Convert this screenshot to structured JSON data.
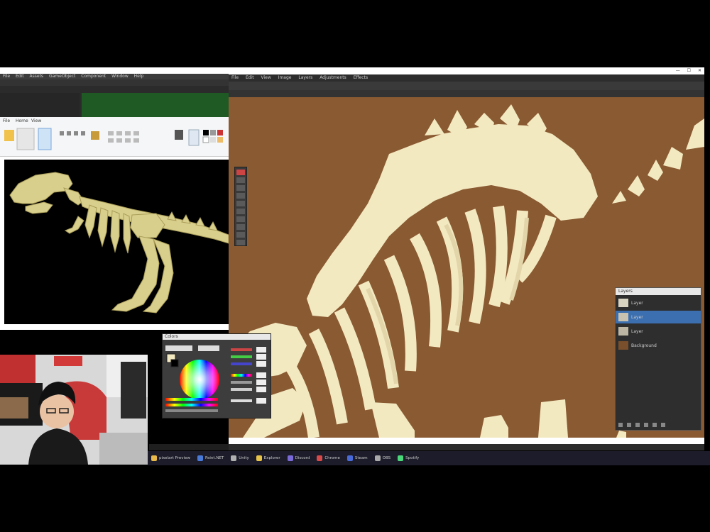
{
  "left_app": {
    "menu": [
      "File",
      "Edit",
      "Assets",
      "GameObject",
      "Component",
      "Window",
      "Help"
    ]
  },
  "paint": {
    "tabs": [
      "File",
      "Home",
      "View"
    ]
  },
  "editor": {
    "menu": [
      "File",
      "Edit",
      "View",
      "Image",
      "Layers",
      "Adjustments",
      "Effects"
    ],
    "statusbar_text": "",
    "window_controls": [
      "—",
      "☐",
      "✕"
    ]
  },
  "colors_panel": {
    "title": "Colors",
    "primary": "#f3e9c1",
    "secondary": "#000000"
  },
  "layers_panel": {
    "title": "Layers",
    "layers": [
      {
        "name": "Layer",
        "color": "#d8d2c0",
        "selected": false
      },
      {
        "name": "Layer",
        "color": "#c9c2b0",
        "selected": true
      },
      {
        "name": "Layer",
        "color": "#bdb6a4",
        "selected": false
      },
      {
        "name": "Background",
        "color": "#7a4f2b",
        "selected": false
      }
    ]
  },
  "taskbar": {
    "items": [
      {
        "label": "pixelart Preview",
        "color": "#e8b84a"
      },
      {
        "label": "Paint.NET",
        "color": "#4a7ad8"
      },
      {
        "label": "Unity",
        "color": "#b0b0b0"
      },
      {
        "label": "Explorer",
        "color": "#e8c34a"
      },
      {
        "label": "Discord",
        "color": "#7a6ad8"
      },
      {
        "label": "Chrome",
        "color": "#d84a4a"
      },
      {
        "label": "Steam",
        "color": "#4a6ad8"
      },
      {
        "label": "OBS",
        "color": "#aaaaaa"
      },
      {
        "label": "Spotify",
        "color": "#4ad87a"
      }
    ],
    "clock_time": "",
    "clock_date": ""
  },
  "canvas": {
    "background": "#8a5a32",
    "bone_color": "#f3e9c1",
    "bone_shadow": "#e2d5a9"
  }
}
